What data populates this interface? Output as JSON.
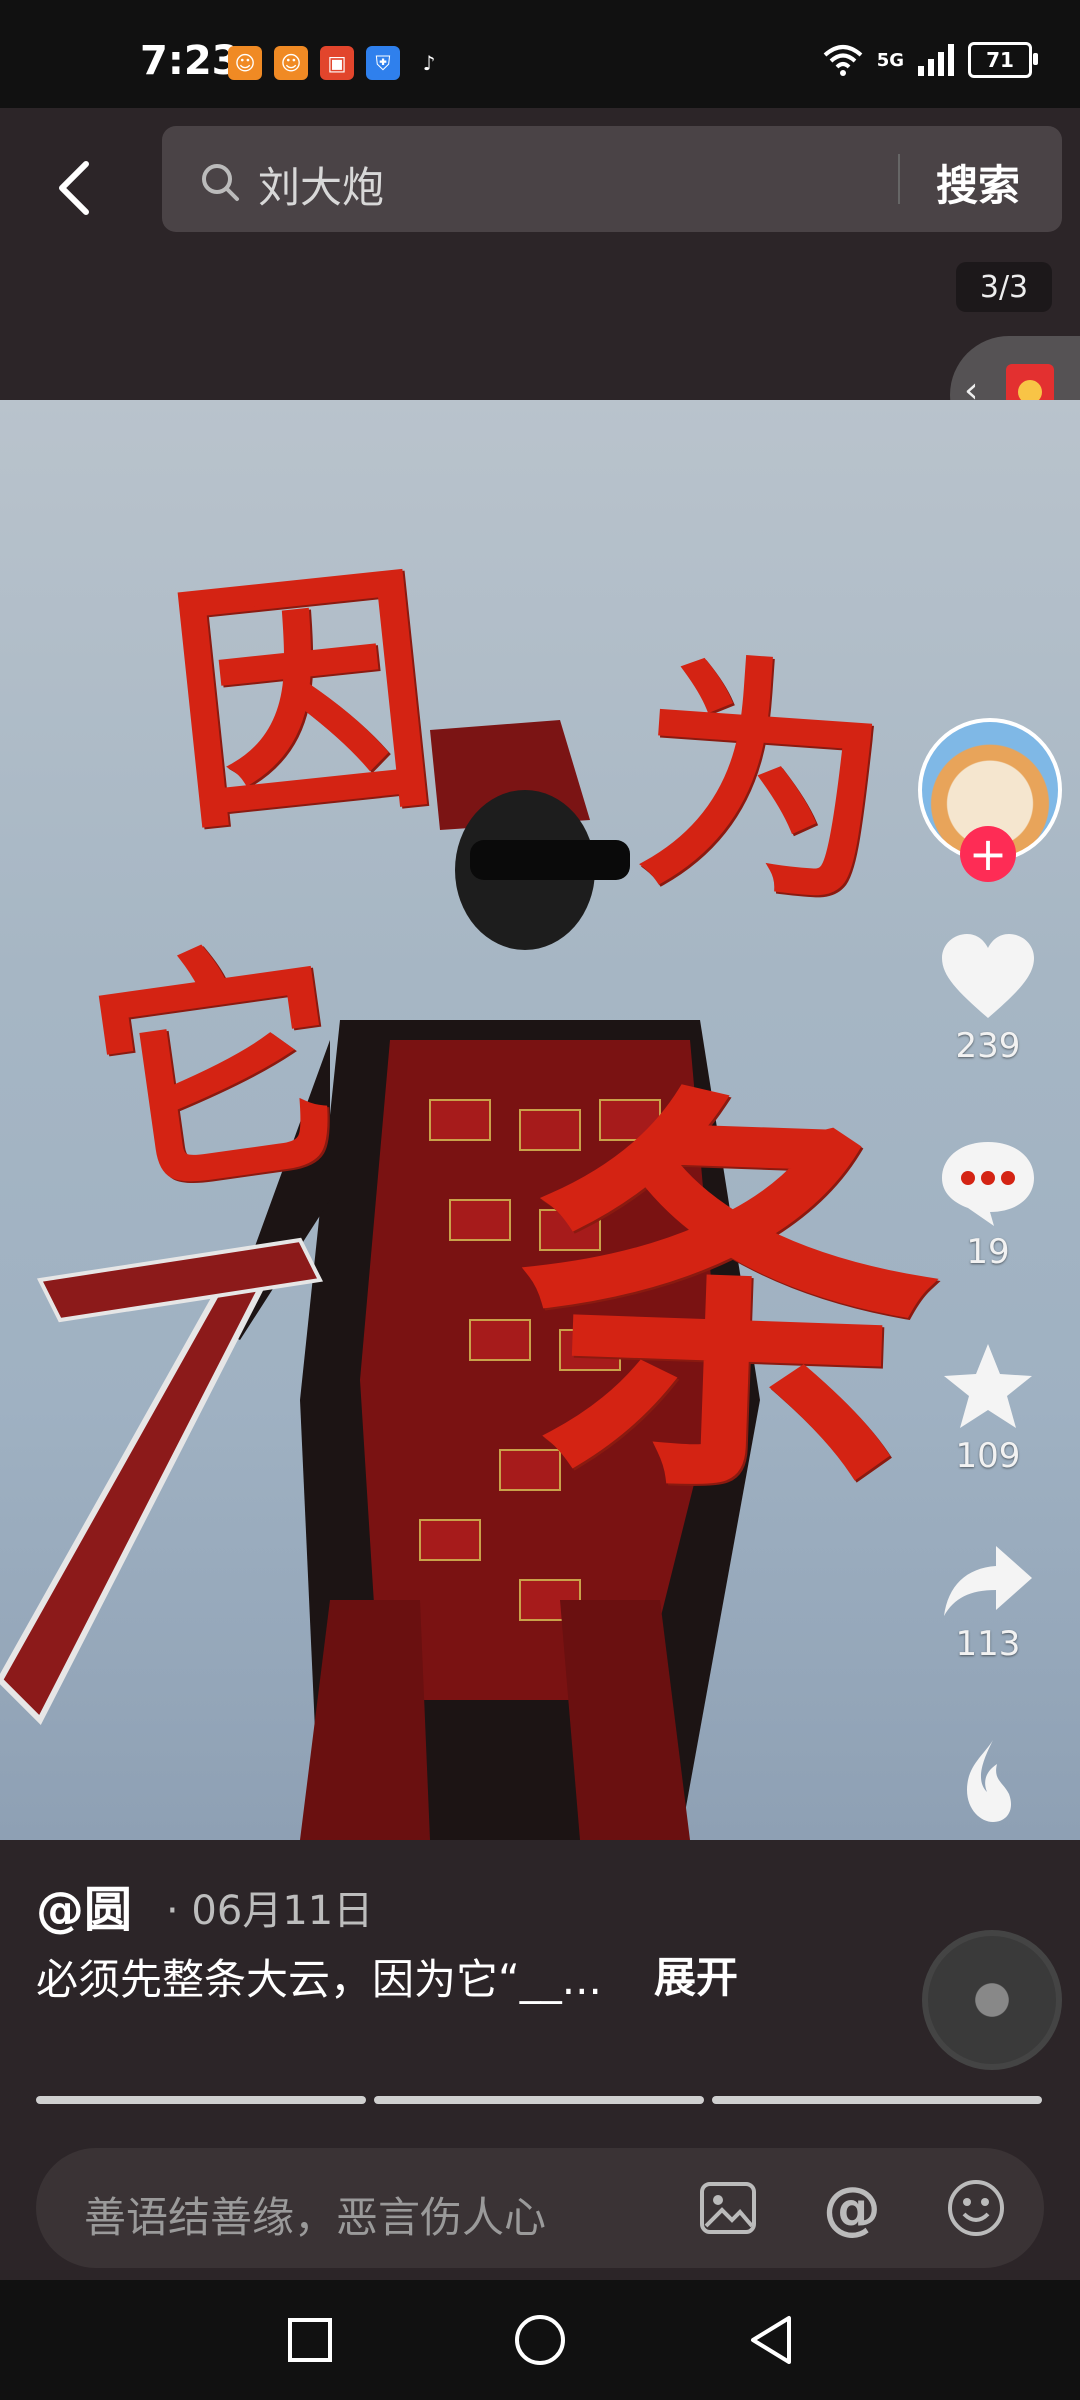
{
  "status_bar": {
    "time": "7:23",
    "network": "5G",
    "battery": "71",
    "app_icons": [
      "app-icon-1",
      "app-icon-2",
      "app-icon-3",
      "shield-icon",
      "tiktok-icon"
    ]
  },
  "search": {
    "query": "刘大炮",
    "button_label": "搜索"
  },
  "media": {
    "page_indicator": "3/3",
    "overlay_text": [
      "因",
      "为",
      "它",
      "条"
    ]
  },
  "actions": {
    "likes": "239",
    "comments": "19",
    "favorites": "109",
    "shares": "113",
    "gift_label": "送火苗"
  },
  "post": {
    "author": "@圆",
    "date": "· 06月11日",
    "caption": "必须先整条大云，因为它“__...",
    "expand_label": "展开",
    "progress_total": 3,
    "progress_current": 3
  },
  "comment_input": {
    "placeholder": "善语结善缘，恶言伤人心"
  },
  "colors": {
    "accent_red": "#fe2c55",
    "calligraphy_red": "#d42313",
    "panel_bg": "#2c2528"
  }
}
